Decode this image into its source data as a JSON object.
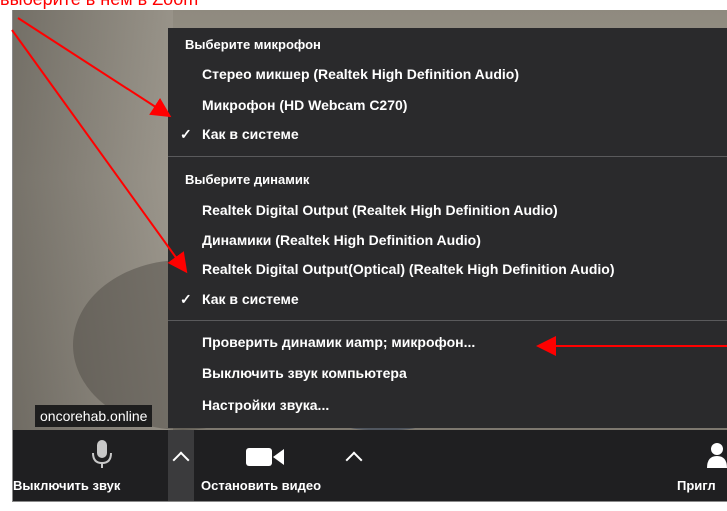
{
  "annotation": {
    "caption": "выберите в нём в Zoom"
  },
  "video": {
    "participant_name": "oncorehab.online"
  },
  "audio_menu": {
    "microphone_header": "Выберите микрофон",
    "microphones": [
      {
        "label": "Стерео микшер (Realtek High Definition Audio)",
        "checked": false
      },
      {
        "label": "Микрофон (HD Webcam C270)",
        "checked": false
      },
      {
        "label": "Как в системе",
        "checked": true
      }
    ],
    "speaker_header": "Выберите динамик",
    "speakers": [
      {
        "label": "Realtek Digital Output (Realtek High Definition Audio)",
        "checked": false
      },
      {
        "label": "Динамики (Realtek High Definition Audio)",
        "checked": false
      },
      {
        "label": "Realtek Digital Output(Optical) (Realtek High Definition Audio)",
        "checked": false
      },
      {
        "label": "Как в системе",
        "checked": true
      }
    ],
    "actions": [
      "Проверить динамик иamp; микрофон...",
      "Выключить звук компьютера",
      "Настройки звука..."
    ],
    "check_mark": "✓"
  },
  "toolbar": {
    "mute_label": "Выключить звук",
    "stop_video_label": "Остановить видео",
    "invite_label": "Пригл"
  },
  "colors": {
    "accent_red": "#ff0000",
    "menu_bg": "#2a2a2c",
    "toolbar_bg": "#1f1f21"
  }
}
